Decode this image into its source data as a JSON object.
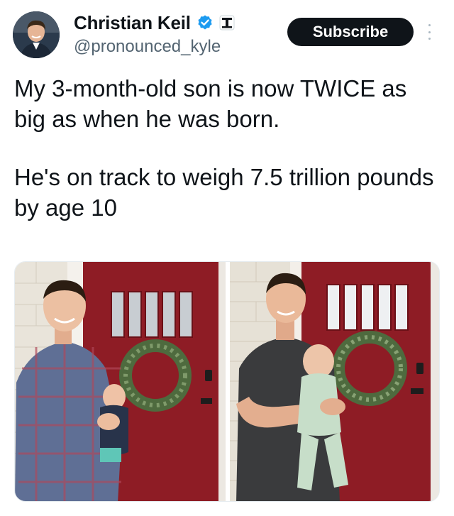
{
  "author": {
    "display_name": "Christian Keil",
    "handle": "@pronounced_kyle",
    "verified_icon": "verified-badge-icon",
    "affiliation_icon": "affiliate-badge-icon"
  },
  "actions": {
    "subscribe_label": "Subscribe",
    "more_icon": "more-vertical-icon"
  },
  "tweet": {
    "paragraphs": [
      "My 3-month-old son is now TWICE as big as when he was born.",
      "He's on track to weigh 7.5 trillion pounds by age 10"
    ]
  },
  "media": {
    "photos": [
      "photo-newborn",
      "photo-three-months"
    ]
  },
  "colors": {
    "text_primary": "#0f1419",
    "text_secondary": "#536471",
    "verified_blue": "#1d9bf0",
    "door_red": "#8e1c25"
  }
}
